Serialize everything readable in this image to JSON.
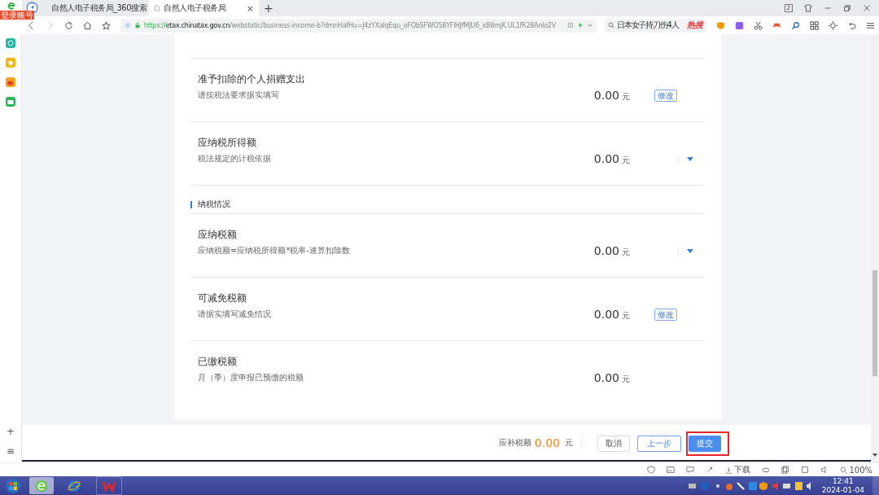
{
  "sidebar": {
    "badge": "登录账号",
    "items": [
      "+",
      "≡"
    ]
  },
  "tabs": [
    {
      "label": "自然人电子税务局_360搜索",
      "selected": false
    },
    {
      "label": "自然人电子税务局",
      "selected": true,
      "close": "×"
    }
  ],
  "new_tab": "+",
  "window_controls": {
    "count": "2"
  },
  "address_bar": {
    "scheme": "https://",
    "host": "etax.chinatax.gov.cn",
    "path": "/webstatic/business-income-b?dmnHafHu=J4zYXaIqEqu_oFObSFWO58YFlHJfMJU6_xB8mjK.UL1fR28AnIo2V"
  },
  "search": {
    "value": "日本女子持刀伤4人",
    "badge": "热搜"
  },
  "rows": [
    {
      "kind": "edit",
      "title": "准予扣除的个人捐赠支出",
      "hint": "请按税法要求据实填写",
      "amount": "0.00",
      "unit": "元",
      "action": "修改"
    },
    {
      "kind": "expand",
      "title": "应纳税所得额",
      "hint": "税法规定的计税依据",
      "amount": "0.00",
      "unit": "元"
    },
    {
      "kind": "section",
      "title": "纳税情况"
    },
    {
      "kind": "expand",
      "title": "应纳税额",
      "hint": "应纳税额=应纳税所得额*税率-速算扣除数",
      "amount": "0.00",
      "unit": "元"
    },
    {
      "kind": "edit",
      "title": "可减免税额",
      "hint": "请据实填写减免情况",
      "amount": "0.00",
      "unit": "元",
      "action": "修改"
    },
    {
      "kind": "plain",
      "title": "已缴税额",
      "hint": "月（季）度申报已预缴的税额",
      "amount": "0.00",
      "unit": "元"
    }
  ],
  "footer": {
    "label": "应补税额",
    "amount": "0.00",
    "unit": "元",
    "buttons": [
      {
        "label": "取消",
        "kind": "plain"
      },
      {
        "label": "上一步",
        "kind": "outline"
      },
      {
        "label": "提交",
        "kind": "primary",
        "highlighted": true
      }
    ]
  },
  "status_bar": {
    "download": "下载",
    "zoom": "100%"
  },
  "taskbar": {
    "time": "12:41",
    "date": "2024-01-04"
  }
}
